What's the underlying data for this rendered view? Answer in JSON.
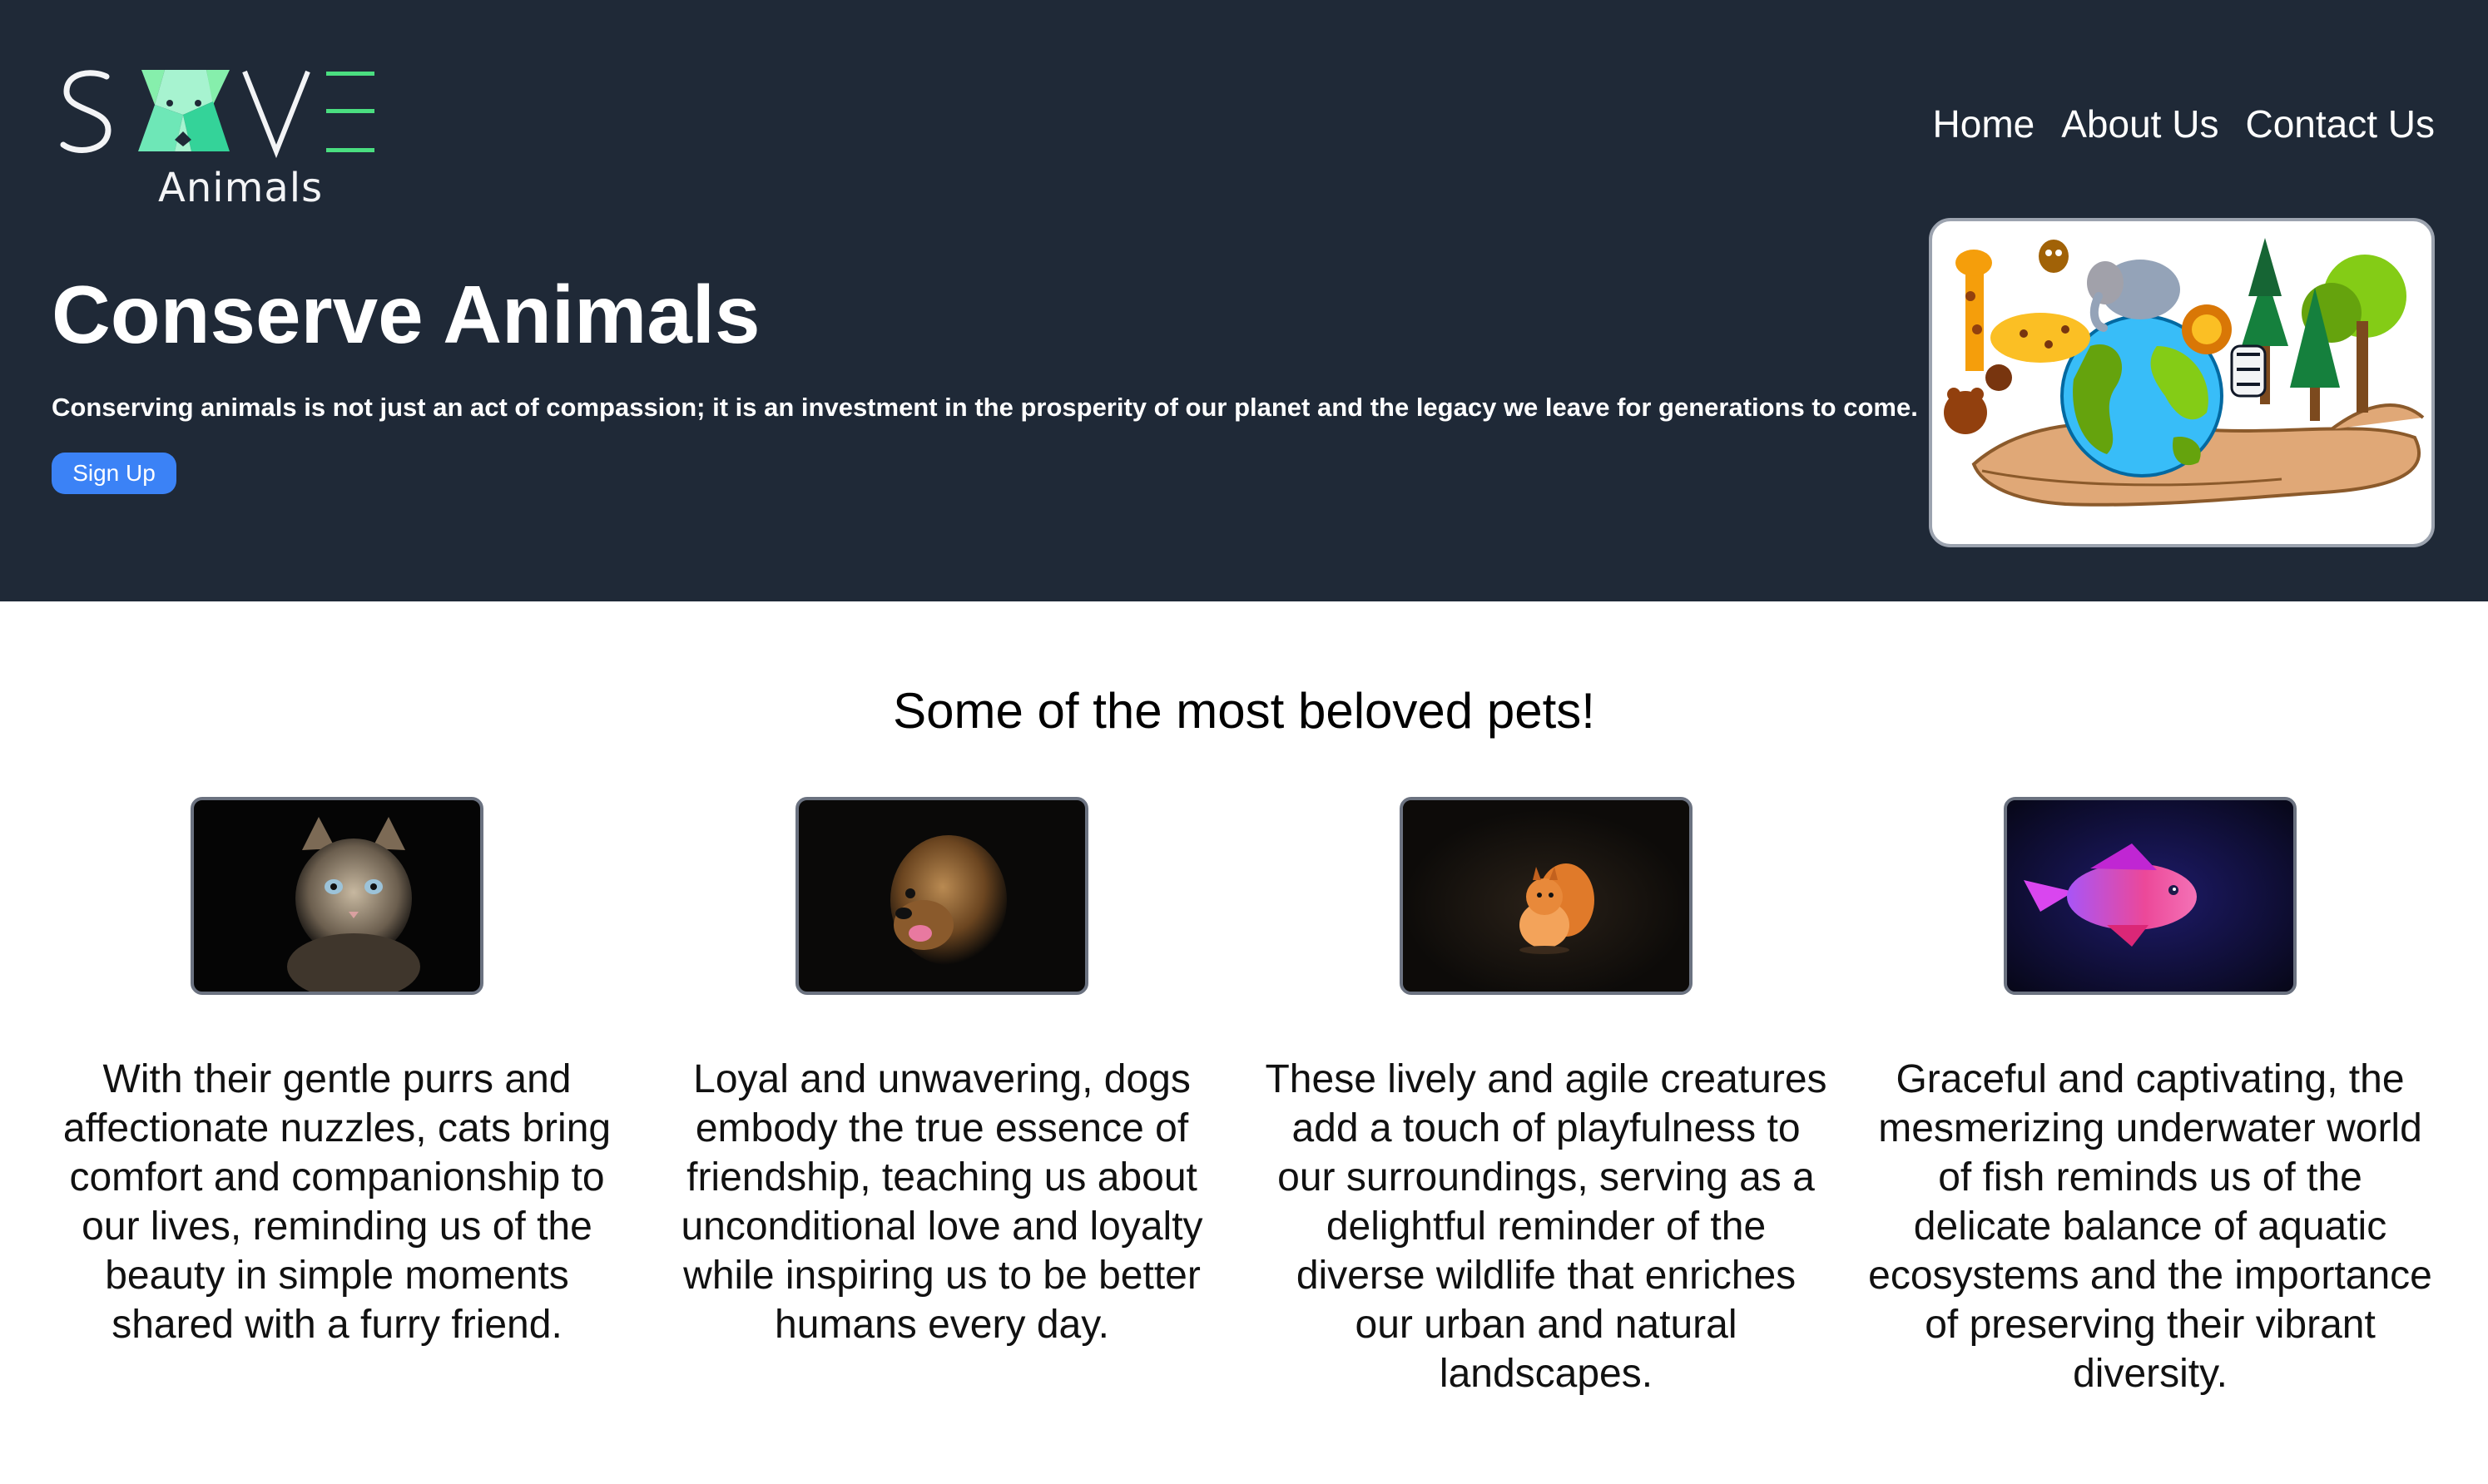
{
  "logo": {
    "word": "SAVE",
    "sub": "Animals"
  },
  "nav": {
    "home": "Home",
    "about": "About Us",
    "contact": "Contact Us"
  },
  "hero": {
    "title": "Conserve Animals",
    "tagline": "Conserving animals is not just an act of compassion; it is an investment in the prosperity of our planet and the legacy we leave for generations to come.",
    "signup_label": "Sign Up"
  },
  "pets": {
    "title": "Some of the most beloved pets!",
    "items": [
      {
        "animal": "cat",
        "text": "With their gentle purrs and affectionate nuzzles, cats bring comfort and companionship to our lives, reminding us of the beauty in simple moments shared with a furry friend."
      },
      {
        "animal": "dog",
        "text": "Loyal and unwavering, dogs embody the true essence of friendship, teaching us about unconditional love and loyalty while inspiring us to be better humans every day."
      },
      {
        "animal": "squirrel",
        "text": "These lively and agile creatures add a touch of playfulness to our surroundings, serving as a delightful reminder of the diverse wildlife that enriches our urban and natural landscapes."
      },
      {
        "animal": "fish",
        "text": "Graceful and captivating, the mesmerizing underwater world of fish reminds us of the delicate balance of aquatic ecosystems and the importance of preserving their vibrant diversity."
      }
    ]
  },
  "colors": {
    "hero_bg": "#1f2937",
    "accent_blue": "#3b82f6",
    "logo_green": "#4ade80"
  }
}
